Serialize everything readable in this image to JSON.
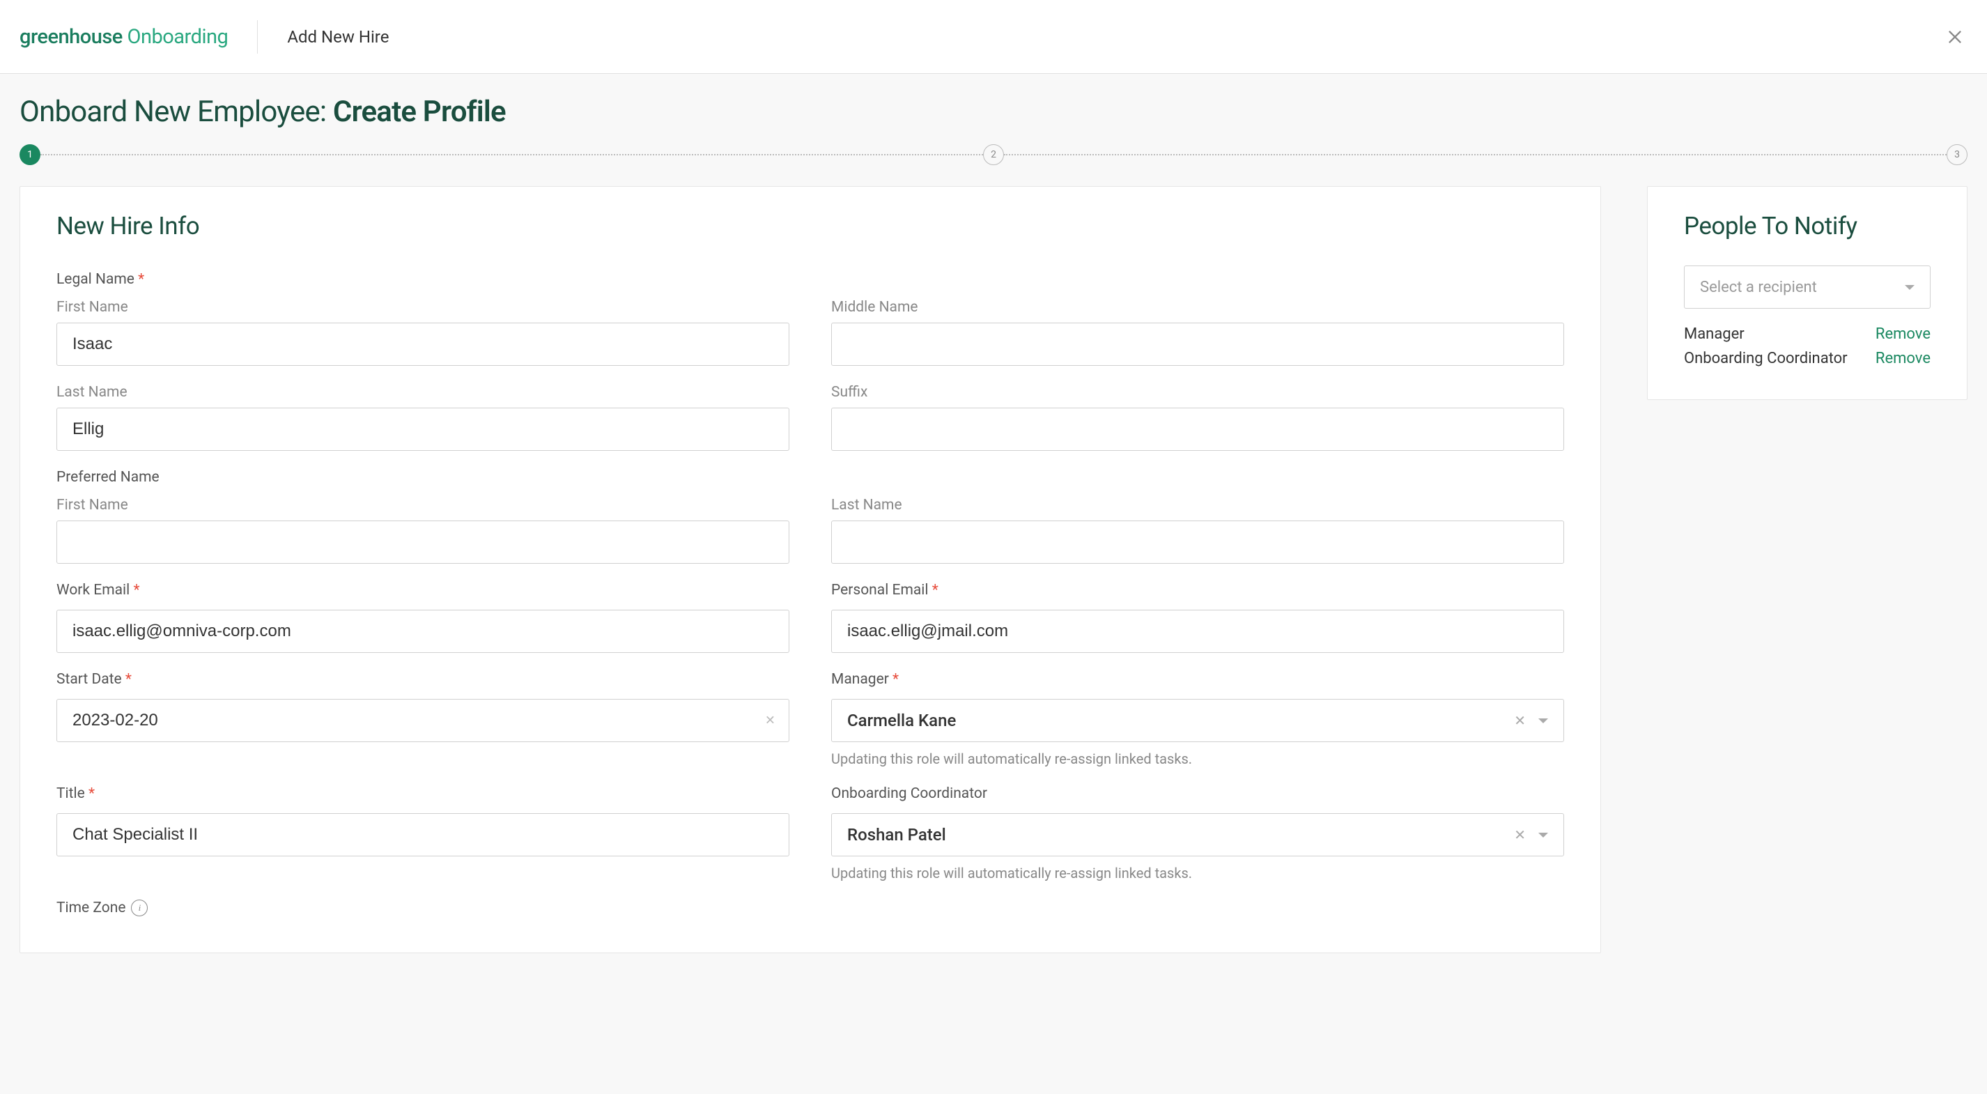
{
  "header": {
    "logo_greenhouse": "greenhouse",
    "logo_onboarding": " Onboarding",
    "page_name": "Add New Hire"
  },
  "heading": {
    "prefix": "Onboard New Employee: ",
    "bold": "Create Profile"
  },
  "stepper": {
    "step1": "1",
    "step2": "2",
    "step3": "3"
  },
  "main": {
    "title": "New Hire Info",
    "legal_name_label": "Legal Name",
    "first_name_label": "First Name",
    "first_name_value": "Isaac",
    "middle_name_label": "Middle Name",
    "middle_name_value": "",
    "last_name_label": "Last Name",
    "last_name_value": "Ellig",
    "suffix_label": "Suffix",
    "suffix_value": "",
    "preferred_name_label": "Preferred Name",
    "pref_first_label": "First Name",
    "pref_first_value": "",
    "pref_last_label": "Last Name",
    "pref_last_value": "",
    "work_email_label": "Work Email",
    "work_email_value": "isaac.ellig@omniva-corp.com",
    "personal_email_label": "Personal Email",
    "personal_email_value": "isaac.ellig@jmail.com",
    "start_date_label": "Start Date",
    "start_date_value": "2023-02-20",
    "manager_label": "Manager",
    "manager_value": "Carmella Kane",
    "manager_help": "Updating this role will automatically re-assign linked tasks.",
    "title_label": "Title",
    "title_value": "Chat Specialist II",
    "coordinator_label": "Onboarding Coordinator",
    "coordinator_value": "Roshan Patel",
    "coordinator_help": "Updating this role will automatically re-assign linked tasks.",
    "timezone_label": "Time Zone"
  },
  "side": {
    "title": "People To Notify",
    "select_placeholder": "Select a recipient",
    "rows": [
      {
        "label": "Manager",
        "action": "Remove"
      },
      {
        "label": "Onboarding Coordinator",
        "action": "Remove"
      }
    ]
  }
}
